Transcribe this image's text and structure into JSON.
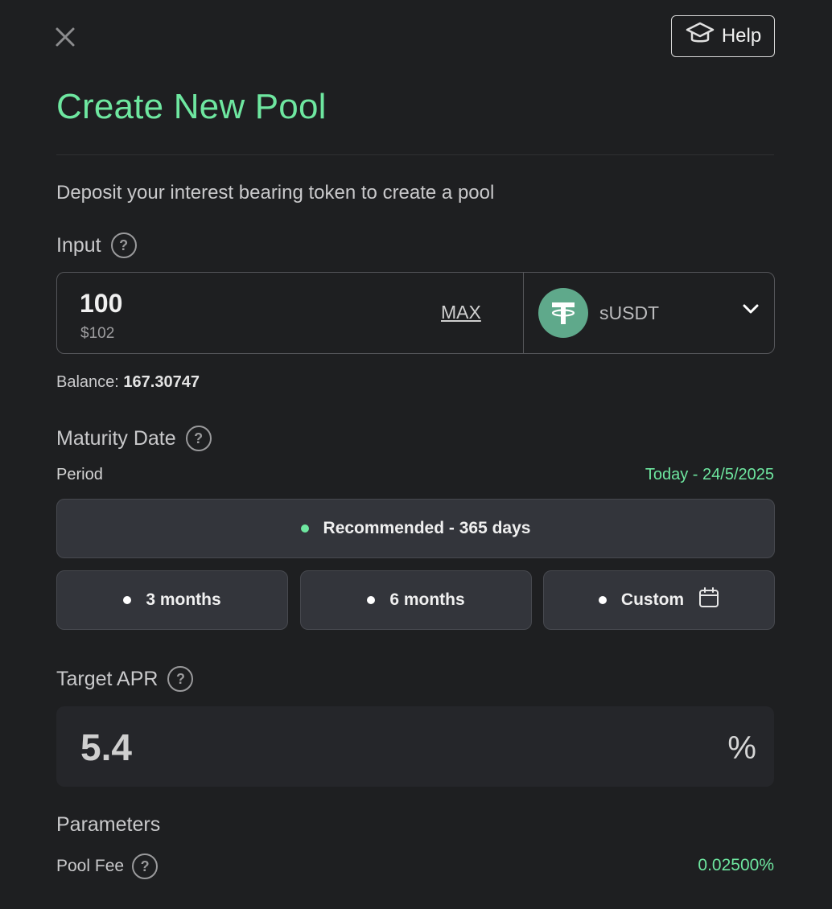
{
  "header": {
    "help_label": "Help",
    "title": "Create New Pool",
    "subtitle": "Deposit your interest bearing token to create a pool"
  },
  "input": {
    "label": "Input",
    "amount": "100",
    "usd_value": "$102",
    "max_label": "MAX",
    "token_name": "sUSDT",
    "balance_label": "Balance:",
    "balance_value": "167.30747"
  },
  "maturity": {
    "label": "Maturity Date",
    "period_label": "Period",
    "period_range": "Today - 24/5/2025",
    "options": [
      {
        "label": "Recommended - 365 days"
      },
      {
        "label": "3 months"
      },
      {
        "label": "6 months"
      },
      {
        "label": "Custom"
      }
    ]
  },
  "apr": {
    "label": "Target APR",
    "value": "5.4",
    "unit": "%"
  },
  "parameters": {
    "label": "Parameters",
    "pool_fee_label": "Pool Fee",
    "pool_fee_value": "0.02500%"
  },
  "colors": {
    "accent": "#6ee7a0",
    "background": "#1e1f21",
    "token_logo": "#5fa98b"
  },
  "icons": [
    "close-icon",
    "graduation-cap-icon",
    "question-icon",
    "tether-icon",
    "chevron-down-icon",
    "calendar-icon"
  ]
}
